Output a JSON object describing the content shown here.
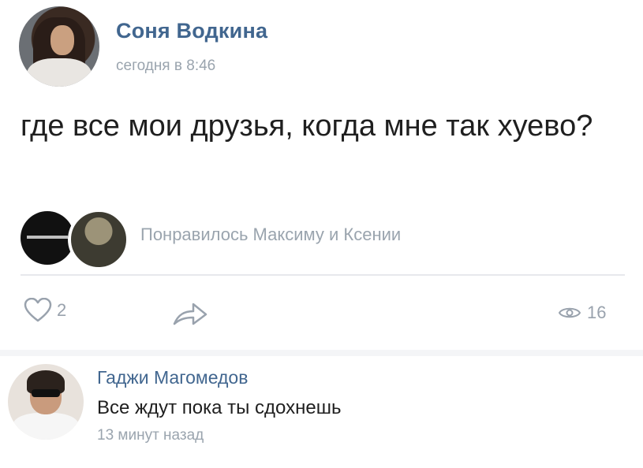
{
  "post": {
    "author_name": "Соня Водкина",
    "time": "сегодня в 8:46",
    "text": "где все мои друзья, когда мне так хуево?",
    "likes_text": "Понравилось Максиму и Ксении",
    "like_count": "2",
    "views_count": "16"
  },
  "comment": {
    "author_name": "Гаджи Магомедов",
    "text": "Все ждут пока ты сдохнешь",
    "time": "13 минут назад"
  },
  "icons": {
    "like": "heart-icon",
    "share": "share-arrow-icon",
    "views": "eye-icon"
  },
  "colors": {
    "name_link": "#41668f",
    "secondary_text": "#9aa4ae",
    "action_icon": "#99a2ad"
  }
}
